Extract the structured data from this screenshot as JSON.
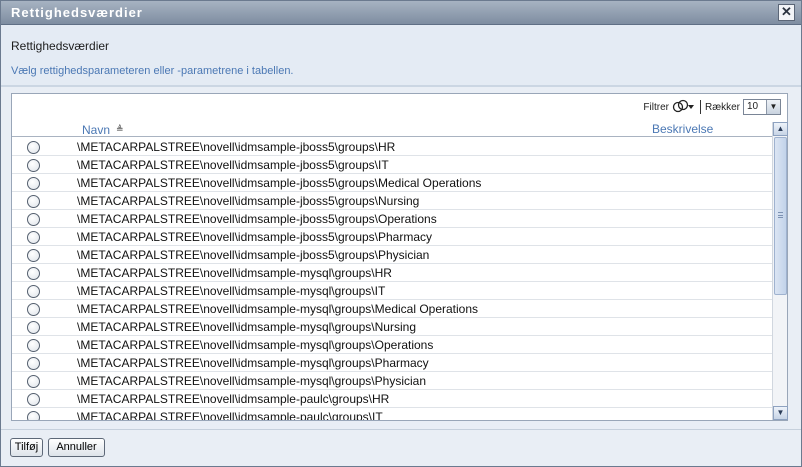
{
  "window": {
    "title": "Rettighedsværdier",
    "close_glyph": "✕"
  },
  "header": {
    "title": "Rettighedsværdier",
    "description": "Vælg rettighedsparameteren eller -parametrene i tabellen."
  },
  "toolbar": {
    "filter_label": "Filtrer",
    "filter_icon": "filter-icon",
    "rows_label": "Rækker",
    "rows_value": "10"
  },
  "table": {
    "columns": {
      "name": "Navn",
      "description": "Beskrivelse"
    },
    "sort": "ascending",
    "rows": [
      "\\METACARPALSTREE\\novell\\idmsample-jboss5\\groups\\HR",
      "\\METACARPALSTREE\\novell\\idmsample-jboss5\\groups\\IT",
      "\\METACARPALSTREE\\novell\\idmsample-jboss5\\groups\\Medical Operations",
      "\\METACARPALSTREE\\novell\\idmsample-jboss5\\groups\\Nursing",
      "\\METACARPALSTREE\\novell\\idmsample-jboss5\\groups\\Operations",
      "\\METACARPALSTREE\\novell\\idmsample-jboss5\\groups\\Pharmacy",
      "\\METACARPALSTREE\\novell\\idmsample-jboss5\\groups\\Physician",
      "\\METACARPALSTREE\\novell\\idmsample-mysql\\groups\\HR",
      "\\METACARPALSTREE\\novell\\idmsample-mysql\\groups\\IT",
      "\\METACARPALSTREE\\novell\\idmsample-mysql\\groups\\Medical Operations",
      "\\METACARPALSTREE\\novell\\idmsample-mysql\\groups\\Nursing",
      "\\METACARPALSTREE\\novell\\idmsample-mysql\\groups\\Operations",
      "\\METACARPALSTREE\\novell\\idmsample-mysql\\groups\\Pharmacy",
      "\\METACARPALSTREE\\novell\\idmsample-mysql\\groups\\Physician",
      "\\METACARPALSTREE\\novell\\idmsample-paulc\\groups\\HR",
      "\\METACARPALSTREE\\novell\\idmsample-paulc\\groups\\IT"
    ]
  },
  "buttons": {
    "add": "Tilføj",
    "cancel": "Annuller"
  },
  "colors": {
    "accent": "#4b78b4",
    "titlebar": "#8d9bae"
  }
}
